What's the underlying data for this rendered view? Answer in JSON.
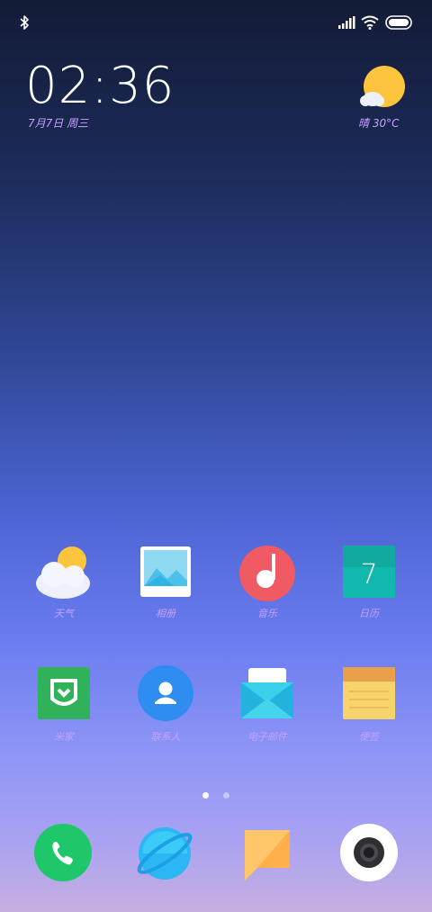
{
  "status_bar": {
    "left_icons": [
      "bluetooth-icon"
    ],
    "right_icons": [
      "signal-icon",
      "wifi-icon",
      "battery-icon"
    ]
  },
  "clock_widget": {
    "time": "02:36",
    "date": "7月7日 周三"
  },
  "weather_widget": {
    "icon": "sun-cloud-icon",
    "summary": "晴 30°C"
  },
  "apps": [
    {
      "label": "天气",
      "icon": "weather-icon"
    },
    {
      "label": "相册",
      "icon": "gallery-icon"
    },
    {
      "label": "音乐",
      "icon": "music-icon"
    },
    {
      "label": "日历",
      "icon": "calendar-icon",
      "badge": "7"
    },
    {
      "label": "米家",
      "icon": "mijia-icon"
    },
    {
      "label": "联系人",
      "icon": "contacts-icon"
    },
    {
      "label": "电子邮件",
      "icon": "email-icon"
    },
    {
      "label": "便签",
      "icon": "notes-icon"
    }
  ],
  "page_indicator": {
    "pages": 2,
    "current": 1
  },
  "dock": [
    {
      "icon": "phone-icon"
    },
    {
      "icon": "browser-icon"
    },
    {
      "icon": "messages-icon"
    },
    {
      "icon": "camera-icon"
    }
  ],
  "colors": {
    "label": "#c7a0ff",
    "phone": "#1ec76a",
    "notes": "#f7d36c",
    "mijia": "#2fb25a"
  }
}
